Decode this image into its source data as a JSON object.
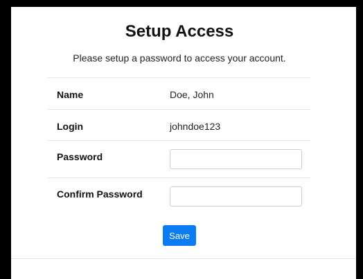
{
  "page": {
    "title": "Setup Access",
    "subtitle": "Please setup a password to access your account."
  },
  "form": {
    "rows": [
      {
        "label": "Name",
        "value": "Doe, John"
      },
      {
        "label": "Login",
        "value": "johndoe123"
      },
      {
        "label": "Password",
        "value": ""
      },
      {
        "label": "Confirm Password",
        "value": ""
      }
    ],
    "save_label": "Save"
  },
  "colors": {
    "accent": "#0d7bf2",
    "frame": "#000000"
  }
}
